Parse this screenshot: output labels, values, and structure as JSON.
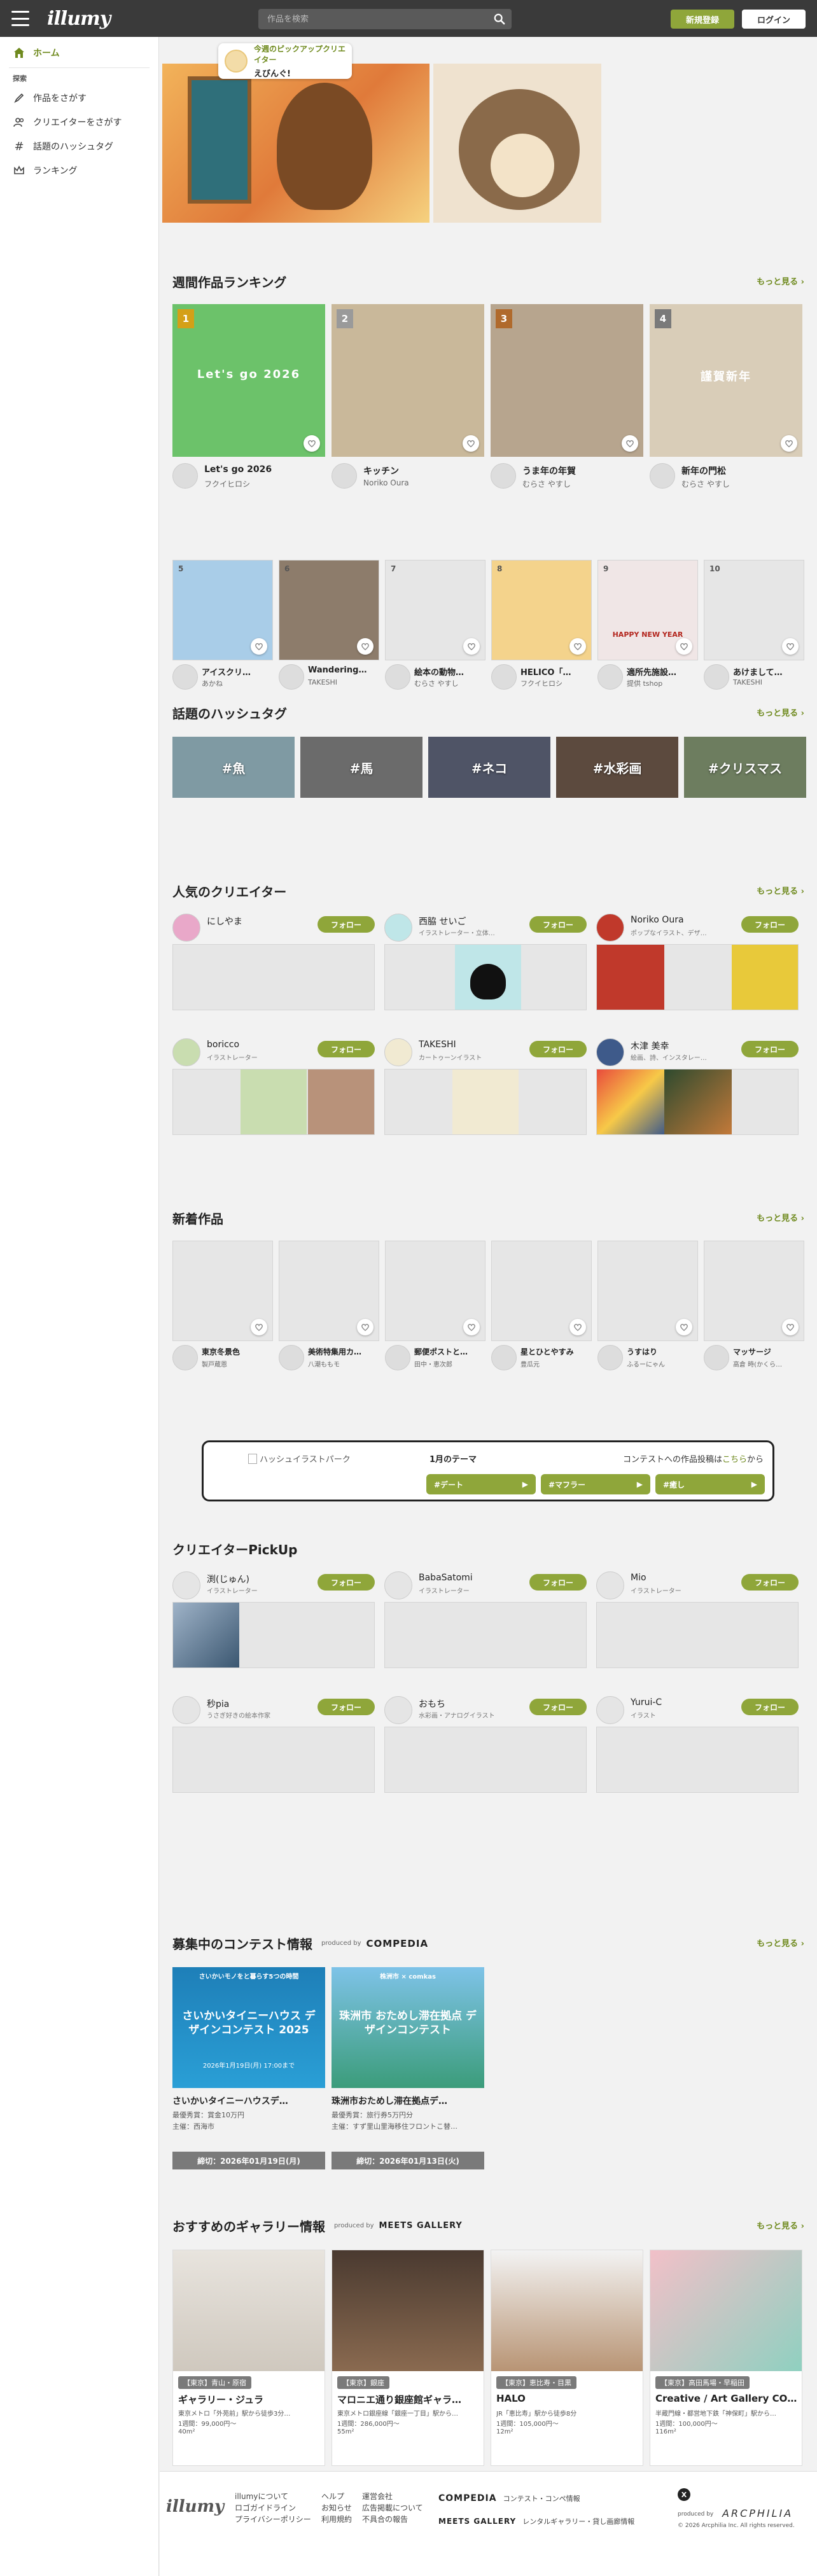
{
  "header": {
    "logo": "illumy",
    "search_placeholder": "作品を検索",
    "register_label": "新規登録",
    "login_label": "ログイン"
  },
  "sidebar": {
    "home": "ホーム",
    "section": "探索",
    "items": [
      {
        "label": "作品をさがす",
        "icon": "paint-brush-icon"
      },
      {
        "label": "クリエイターをさがす",
        "icon": "users-icon"
      },
      {
        "label": "話題のハッシュタグ",
        "icon": "hash-icon"
      },
      {
        "label": "ランキング",
        "icon": "crown-icon"
      }
    ]
  },
  "pickup": {
    "line1": "今週のピックアップクリエイター",
    "line2": "えびんぐ!"
  },
  "weekly_ranking": {
    "title": "週間作品ランキング",
    "more": "もっと見る",
    "top": [
      {
        "rank": "1",
        "title": "Let's go 2026",
        "author": "フクイヒロシ",
        "art_text": "Let's go 2026",
        "art_color": "#6cc26a"
      },
      {
        "rank": "2",
        "title": "キッチン",
        "author": "Noriko Oura",
        "art_color": "#c9b89a"
      },
      {
        "rank": "3",
        "title": "うま年の年賀",
        "author": "むらさ やすし",
        "art_color": "#b7a58e"
      },
      {
        "rank": "4",
        "title": "新年の門松",
        "author": "むらさ やすし",
        "art_text": "謹賀新年",
        "art_color": "#d9cdb8"
      }
    ],
    "rest": [
      {
        "rank": "5",
        "title": "アイスクリ…",
        "author": "あかね",
        "art_color": "#a9cde8"
      },
      {
        "rank": "6",
        "title": "Wandering…",
        "author": "TAKESHI",
        "art_color": "#8d7c6b"
      },
      {
        "rank": "7",
        "title": "絵本の動物…",
        "author": "むらさ やすし",
        "art_color": ""
      },
      {
        "rank": "8",
        "title": "HELICO「…",
        "author": "フクイヒロシ",
        "art_color": "#f4d38c"
      },
      {
        "rank": "9",
        "title": "適所先施設…",
        "author": "提供 tshop",
        "art_text": "HAPPY NEW YEAR",
        "art_color": "#f0e6e6"
      },
      {
        "rank": "10",
        "title": "あけまして…",
        "author": "TAKESHI",
        "art_color": ""
      }
    ]
  },
  "hashtags": {
    "title": "話題のハッシュタグ",
    "more": "もっと見る",
    "items": [
      {
        "label": "#魚",
        "color": "#7f9aa3"
      },
      {
        "label": "#馬",
        "color": "#6b6b6b"
      },
      {
        "label": "#ネコ",
        "color": "#4f5466"
      },
      {
        "label": "#水彩画",
        "color": "#5c4a3e"
      },
      {
        "label": "#クリスマス",
        "color": "#6d7d5f"
      }
    ]
  },
  "popular_creators": {
    "title": "人気のクリエイター",
    "more": "もっと見る",
    "follow_label": "フォロー",
    "items": [
      {
        "name": "にしやま",
        "role": "",
        "art": "none",
        "color": "#e9a8c9"
      },
      {
        "name": "西脇 せいご",
        "role": "イラストレーター・立体…",
        "art": "cat",
        "color": "#bfe6e8"
      },
      {
        "name": "Noriko Oura",
        "role": "ポップなイラスト、デザ…",
        "art": "newyear",
        "color": "#c0392b"
      },
      {
        "name": "boricco",
        "role": "イラストレーター",
        "art": "calendar",
        "color": "#c9ddb0"
      },
      {
        "name": "TAKESHI",
        "role": "カートゥーンイラスト",
        "art": "poster",
        "color": "#f1ead2"
      },
      {
        "name": "木津 美幸",
        "role": "絵画、詩、インスタレー…",
        "art": "colorful",
        "color": "#3e5a8a"
      }
    ]
  },
  "new_works": {
    "title": "新着作品",
    "more": "もっと見る",
    "items": [
      {
        "title": "東京冬景色",
        "author": "製戸蔵恩"
      },
      {
        "title": "美術特集用カ…",
        "author": "八潮ももモ"
      },
      {
        "title": "郵便ポストと…",
        "author": "田中・恵次郎"
      },
      {
        "title": "星とひとやすみ",
        "author": "豊瓜元"
      },
      {
        "title": "うすはり",
        "author": "ふるーにゃん"
      },
      {
        "title": "マッサージ",
        "author": "高倉 時(かくら…"
      }
    ]
  },
  "hashi_park": {
    "alt": "ハッシュイラストパーク",
    "theme_label": "1月のテーマ",
    "contest_text": "コンテストへの作品投稿は",
    "contest_link": "こちら",
    "contest_suffix": "から",
    "tags": [
      "#デート",
      "#マフラー",
      "#癒し"
    ]
  },
  "creator_pickup": {
    "title": "クリエイターPickUp",
    "follow_label": "フォロー",
    "items": [
      {
        "name": "渕(じゅん)",
        "role": "イラストレーター",
        "art": "couple"
      },
      {
        "name": "BabaSatomi",
        "role": "イラストレーター",
        "art": "none"
      },
      {
        "name": "Mio",
        "role": "イラストレーター",
        "art": "none"
      },
      {
        "name": "秒pia",
        "role": "うさぎ好きの絵本作家",
        "art": "none"
      },
      {
        "name": "おもち",
        "role": "水彩画・アナログイラスト",
        "art": "none"
      },
      {
        "name": "Yurui-C",
        "role": "イラスト",
        "art": "none"
      }
    ]
  },
  "contests": {
    "title": "募集中のコンテスト情報",
    "produced_by": "produced by",
    "brand": "COMPEDIA",
    "more": "もっと見る",
    "items": [
      {
        "banner_top": "さいかいモノをと暮らす5つの時間",
        "banner_title": "さいかいタイニーハウス デザインコンテスト 2025",
        "banner_date": "2026年1月19日(月) 17:00まで",
        "title": "さいかいタイニーハウスデ…",
        "prize": "最優秀賞：賞金10万円",
        "host": "主催：西海市",
        "deadline": "締切：2026年01月19日(月)"
      },
      {
        "banner_top": "株洲市 × comkas",
        "banner_title": "珠洲市 おためし滞在拠点 デザインコンテスト",
        "banner_date": "",
        "title": "珠洲市おためし滞在拠点デ…",
        "prize": "最優秀賞：旅行券5万円分",
        "host": "主催：すず里山里海移住フロントこ替…",
        "deadline": "締切：2026年01月13日(火)"
      }
    ]
  },
  "galleries": {
    "title": "おすすめのギャラリー情報",
    "produced_by": "produced by",
    "brand": "MEETS GALLERY",
    "more": "もっと見る",
    "items": [
      {
        "area": "【東京】青山・原宿",
        "name": "ギャラリー・ジュラ",
        "access": "東京メトロ「外苑前」駅から徒歩3分…",
        "price": "1週間：99,000円〜",
        "size": "40m²"
      },
      {
        "area": "【東京】銀座",
        "name": "マロニエ通り銀座館ギャラ…",
        "access": "東京メトロ銀座線「銀座一丁目」駅から…",
        "price": "1週間：286,000円〜",
        "size": "55m²"
      },
      {
        "area": "【東京】恵比寿・目黒",
        "name": "HALO",
        "access": "JR「恵比寿」駅から徒歩8分",
        "price": "1週間：105,000円〜",
        "size": "12m²"
      },
      {
        "area": "【東京】高田馬場・早稲田",
        "name": "Creative / Art Gallery COR…",
        "access": "半蔵門線・都営地下鉄「神保町」駅から…",
        "price": "1週間：100,000円〜",
        "size": "116m²"
      }
    ]
  },
  "footer": {
    "logo": "illumy",
    "col1": [
      "illumyについて",
      "ロゴガイドライン",
      "プライバシーポリシー"
    ],
    "col2": [
      "ヘルプ",
      "お知らせ",
      "利用規約"
    ],
    "col3": [
      "運営会社",
      "広告掲載について",
      "不具合の報告"
    ],
    "compedia": "COMPEDIA",
    "compedia_label": "コンテスト・コンペ情報",
    "meets": "MEETS GALLERY",
    "meets_label": "レンタルギャラリー・貸し画廊情報",
    "produced_by": "produced by",
    "company": "ARCPHILIA",
    "copyright": "© 2026 Arcphilia Inc. All rights reserved."
  }
}
